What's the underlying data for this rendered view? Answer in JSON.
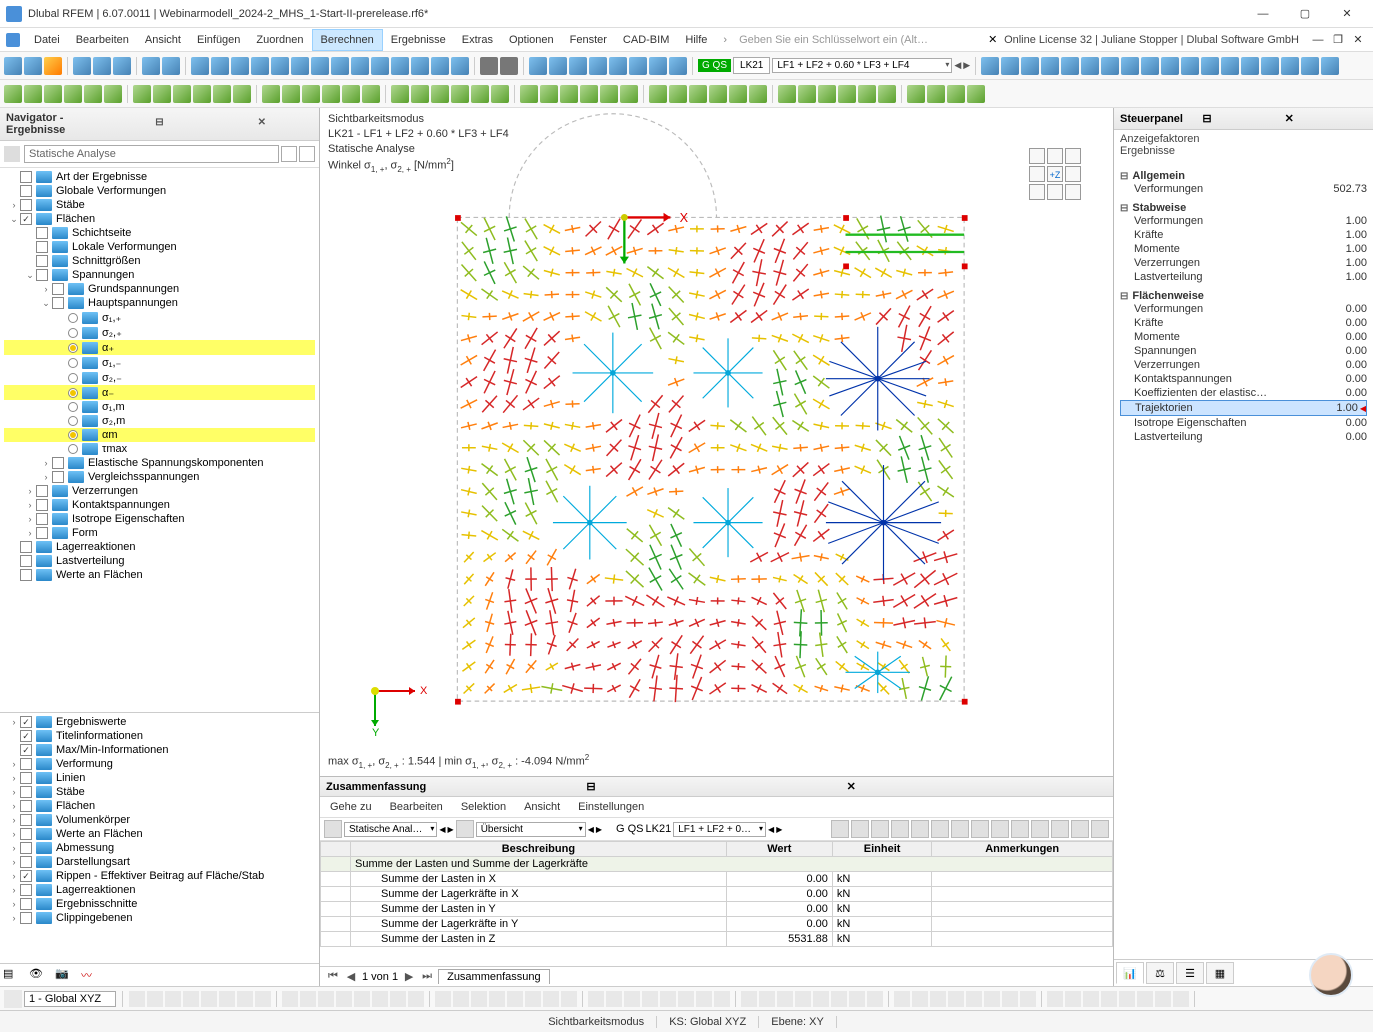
{
  "titlebar": {
    "app": "Dlubal RFEM",
    "version": "6.07.0011",
    "file": "Webinarmodell_2024-2_MHS_1-Start-II-prerelease.rf6*"
  },
  "menu": [
    "Datei",
    "Bearbeiten",
    "Ansicht",
    "Einfügen",
    "Zuordnen",
    "Berechnen",
    "Ergebnisse",
    "Extras",
    "Optionen",
    "Fenster",
    "CAD-BIM",
    "Hilfe"
  ],
  "menu_active_index": 5,
  "search_placeholder": "Geben Sie ein Schlüsselwort ein (Alt…",
  "license_text": "Online License 32 | Juliane Stopper | Dlubal Software GmbH",
  "toolbar_combo1": {
    "lk": "LK21",
    "expr": "LF1 + LF2 + 0.60 * LF3 + LF4"
  },
  "navigator": {
    "title": "Navigator - Ergebnisse",
    "combo": "Statische Analyse",
    "tree_top": [
      {
        "lvl": 0,
        "arrow": "",
        "chk": false,
        "label": "Art der Ergebnisse"
      },
      {
        "lvl": 0,
        "arrow": "",
        "chk": false,
        "label": "Globale Verformungen"
      },
      {
        "lvl": 0,
        "arrow": "›",
        "chk": false,
        "label": "Stäbe"
      },
      {
        "lvl": 0,
        "arrow": "⌄",
        "chk": true,
        "label": "Flächen"
      },
      {
        "lvl": 1,
        "arrow": "",
        "chk": false,
        "label": "Schichtseite"
      },
      {
        "lvl": 1,
        "arrow": "",
        "chk": false,
        "label": "Lokale Verformungen"
      },
      {
        "lvl": 1,
        "arrow": "",
        "chk": false,
        "label": "Schnittgrößen"
      },
      {
        "lvl": 1,
        "arrow": "⌄",
        "chk": false,
        "label": "Spannungen"
      },
      {
        "lvl": 2,
        "arrow": "›",
        "chk": false,
        "label": "Grundspannungen"
      },
      {
        "lvl": 2,
        "arrow": "⌄",
        "chk": false,
        "label": "Hauptspannungen"
      },
      {
        "lvl": 3,
        "arrow": "",
        "rad": false,
        "label": "σ₁,₊"
      },
      {
        "lvl": 3,
        "arrow": "",
        "rad": false,
        "label": "σ₂,₊"
      },
      {
        "lvl": 3,
        "arrow": "",
        "rad": true,
        "hl": true,
        "label": "α₊"
      },
      {
        "lvl": 3,
        "arrow": "",
        "rad": false,
        "label": "σ₁,₋"
      },
      {
        "lvl": 3,
        "arrow": "",
        "rad": false,
        "label": "σ₂,₋"
      },
      {
        "lvl": 3,
        "arrow": "",
        "rad": true,
        "hl": true,
        "label": "α₋"
      },
      {
        "lvl": 3,
        "arrow": "",
        "rad": false,
        "label": "σ₁,m"
      },
      {
        "lvl": 3,
        "arrow": "",
        "rad": false,
        "label": "σ₂,m"
      },
      {
        "lvl": 3,
        "arrow": "",
        "rad": true,
        "hl": true,
        "label": "αm"
      },
      {
        "lvl": 3,
        "arrow": "",
        "rad": false,
        "label": "τmax"
      },
      {
        "lvl": 2,
        "arrow": "›",
        "chk": false,
        "label": "Elastische Spannungskomponenten"
      },
      {
        "lvl": 2,
        "arrow": "›",
        "chk": false,
        "label": "Vergleichsspannungen"
      },
      {
        "lvl": 1,
        "arrow": "›",
        "chk": false,
        "label": "Verzerrungen"
      },
      {
        "lvl": 1,
        "arrow": "›",
        "chk": false,
        "label": "Kontaktspannungen"
      },
      {
        "lvl": 1,
        "arrow": "›",
        "chk": false,
        "label": "Isotrope Eigenschaften"
      },
      {
        "lvl": 1,
        "arrow": "›",
        "chk": false,
        "label": "Form"
      },
      {
        "lvl": 0,
        "arrow": "",
        "chk": false,
        "label": "Lagerreaktionen"
      },
      {
        "lvl": 0,
        "arrow": "",
        "chk": false,
        "label": "Lastverteilung"
      },
      {
        "lvl": 0,
        "arrow": "",
        "chk": false,
        "label": "Werte an Flächen"
      }
    ],
    "tree_bottom": [
      {
        "lvl": 0,
        "arrow": "›",
        "chk": true,
        "label": "Ergebniswerte"
      },
      {
        "lvl": 0,
        "arrow": "",
        "chk": true,
        "label": "Titelinformationen"
      },
      {
        "lvl": 0,
        "arrow": "",
        "chk": true,
        "label": "Max/Min-Informationen"
      },
      {
        "lvl": 0,
        "arrow": "›",
        "chk": false,
        "label": "Verformung"
      },
      {
        "lvl": 0,
        "arrow": "›",
        "chk": false,
        "label": "Linien"
      },
      {
        "lvl": 0,
        "arrow": "›",
        "chk": false,
        "label": "Stäbe"
      },
      {
        "lvl": 0,
        "arrow": "›",
        "chk": false,
        "label": "Flächen"
      },
      {
        "lvl": 0,
        "arrow": "›",
        "chk": false,
        "label": "Volumenkörper"
      },
      {
        "lvl": 0,
        "arrow": "›",
        "chk": false,
        "label": "Werte an Flächen"
      },
      {
        "lvl": 0,
        "arrow": "›",
        "chk": false,
        "label": "Abmessung"
      },
      {
        "lvl": 0,
        "arrow": "›",
        "chk": false,
        "label": "Darstellungsart"
      },
      {
        "lvl": 0,
        "arrow": "›",
        "chk": true,
        "label": "Rippen - Effektiver Beitrag auf Fläche/Stab"
      },
      {
        "lvl": 0,
        "arrow": "›",
        "chk": false,
        "label": "Lagerreaktionen"
      },
      {
        "lvl": 0,
        "arrow": "›",
        "chk": false,
        "label": "Ergebnisschnitte"
      },
      {
        "lvl": 0,
        "arrow": "›",
        "chk": false,
        "label": "Clippingebenen"
      }
    ]
  },
  "viewport": {
    "line1": "Sichtbarkeitsmodus",
    "line2": "LK21 - LF1 + LF2 + 0.60 * LF3 + LF4",
    "line3": "Statische Analyse",
    "line4_prefix": "Winkel σ",
    "line4_sub1": "1, +",
    "line4_mid": ", σ",
    "line4_sub2": "2, +",
    "line4_unit": " [N/mm",
    "line4_sup": "2",
    "line4_end": "]",
    "bottom_prefix": "max σ",
    "bottom_s1": "1, +",
    "bottom_m1": ", σ",
    "bottom_s2": "2, +",
    "bottom_v1": " : 1.544 | min σ",
    "bottom_s3": "1, +",
    "bottom_m2": ", σ",
    "bottom_s4": "2, +",
    "bottom_v2": " : -4.094 N/mm",
    "bottom_sup": "2",
    "axis_x": "X",
    "axis_y": "Y",
    "axis_z": "+Z"
  },
  "panel": {
    "title": "Steuerpanel",
    "headline1": "Anzeigefaktoren",
    "headline2": "Ergebnisse",
    "groups": [
      {
        "name": "Allgemein",
        "rows": [
          {
            "k": "Verformungen",
            "v": "502.73"
          }
        ]
      },
      {
        "name": "Stabweise",
        "rows": [
          {
            "k": "Verformungen",
            "v": "1.00"
          },
          {
            "k": "Kräfte",
            "v": "1.00"
          },
          {
            "k": "Momente",
            "v": "1.00"
          },
          {
            "k": "Verzerrungen",
            "v": "1.00"
          },
          {
            "k": "Lastverteilung",
            "v": "1.00"
          }
        ]
      },
      {
        "name": "Flächenweise",
        "rows": [
          {
            "k": "Verformungen",
            "v": "0.00"
          },
          {
            "k": "Kräfte",
            "v": "0.00"
          },
          {
            "k": "Momente",
            "v": "0.00"
          },
          {
            "k": "Spannungen",
            "v": "0.00"
          },
          {
            "k": "Verzerrungen",
            "v": "0.00"
          },
          {
            "k": "Kontaktspannungen",
            "v": "0.00"
          },
          {
            "k": "Koeffizienten der elastisc…",
            "v": "0.00"
          },
          {
            "k": "Trajektorien",
            "v": "1.00",
            "sel": true
          },
          {
            "k": "Isotrope Eigenschaften",
            "v": "0.00"
          },
          {
            "k": "Lastverteilung",
            "v": "0.00"
          }
        ]
      }
    ]
  },
  "summary": {
    "title": "Zusammenfassung",
    "menu": [
      "Gehe zu",
      "Bearbeiten",
      "Selektion",
      "Ansicht",
      "Einstellungen"
    ],
    "combo1": "Statische Anal…",
    "combo2": "Übersicht",
    "lk": "LK21",
    "expr": "LF1 + LF2 + 0…",
    "headers": [
      "Beschreibung",
      "Wert",
      "Einheit",
      "Anmerkungen"
    ],
    "group_header": "Summe der Lasten und Summe der Lagerkräfte",
    "rows": [
      {
        "b": "Summe der Lasten in X",
        "w": "0.00",
        "e": "kN",
        "a": ""
      },
      {
        "b": "Summe der Lagerkräfte in X",
        "w": "0.00",
        "e": "kN",
        "a": ""
      },
      {
        "b": "Summe der Lasten in Y",
        "w": "0.00",
        "e": "kN",
        "a": ""
      },
      {
        "b": "Summe der Lagerkräfte in Y",
        "w": "0.00",
        "e": "kN",
        "a": ""
      },
      {
        "b": "Summe der Lasten in Z",
        "w": "5531.88",
        "e": "kN",
        "a": ""
      }
    ],
    "pager": "1 von 1",
    "tab": "Zusammenfassung"
  },
  "bottombar": {
    "ucs": "1 - Global XYZ"
  },
  "statusbar": {
    "c1": "Sichtbarkeitsmodus",
    "c2": "KS: Global XYZ",
    "c3": "Ebene: XY"
  },
  "gqs_label": "G QS"
}
